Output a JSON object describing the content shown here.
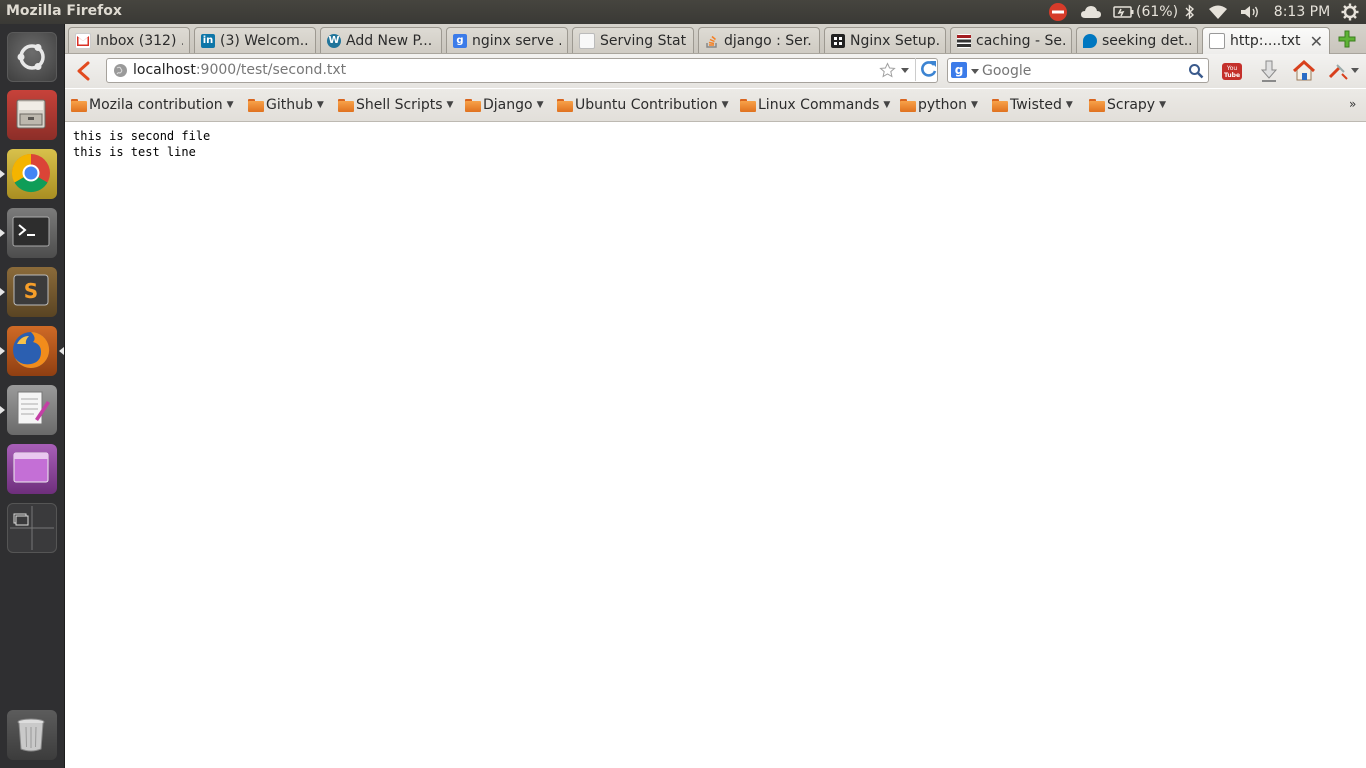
{
  "panel": {
    "window_title": "Mozilla Firefox",
    "battery": "(61%)",
    "clock": "8:13 PM"
  },
  "launcher": {
    "items": [
      "dash-home",
      "files",
      "chrome",
      "terminal",
      "sublime-text",
      "firefox",
      "text-editor",
      "workspace-app",
      "workspace-switcher",
      "trash"
    ]
  },
  "tabs": [
    {
      "title": "Inbox (312) ...",
      "icon": "gmail-icon",
      "active": false
    },
    {
      "title": "(3) Welcom...",
      "icon": "linkedin-icon",
      "active": false
    },
    {
      "title": "Add New P...",
      "icon": "wordpress-icon",
      "active": false
    },
    {
      "title": "nginx serve ...",
      "icon": "google-icon",
      "active": false
    },
    {
      "title": "Serving Stat...",
      "icon": "page-icon",
      "active": false
    },
    {
      "title": "django : Ser...",
      "icon": "stackoverflow-icon",
      "active": false
    },
    {
      "title": "Nginx Setup...",
      "icon": "github-icon",
      "active": false
    },
    {
      "title": "caching - Se...",
      "icon": "serverfault-icon",
      "active": false
    },
    {
      "title": "seeking det...",
      "icon": "drupal-icon",
      "active": false
    },
    {
      "title": "http:....txt",
      "icon": "blank-page-icon",
      "active": true
    }
  ],
  "navbar": {
    "url_host": "localhost",
    "url_rest": ":9000/test/second.txt",
    "search_placeholder": "Google"
  },
  "bookmarks": [
    "Mozila contribution",
    "Github",
    "Shell Scripts",
    "Django",
    "Ubuntu Contribution",
    "Linux Commands",
    "python",
    "Twisted",
    "Scrapy"
  ],
  "content": {
    "text": "this is second file\nthis is test line"
  },
  "colors": {
    "panel_bg": "#3c3b37",
    "launcher_bg": "#2f2f31",
    "folder_orange": "#f39a3e"
  }
}
